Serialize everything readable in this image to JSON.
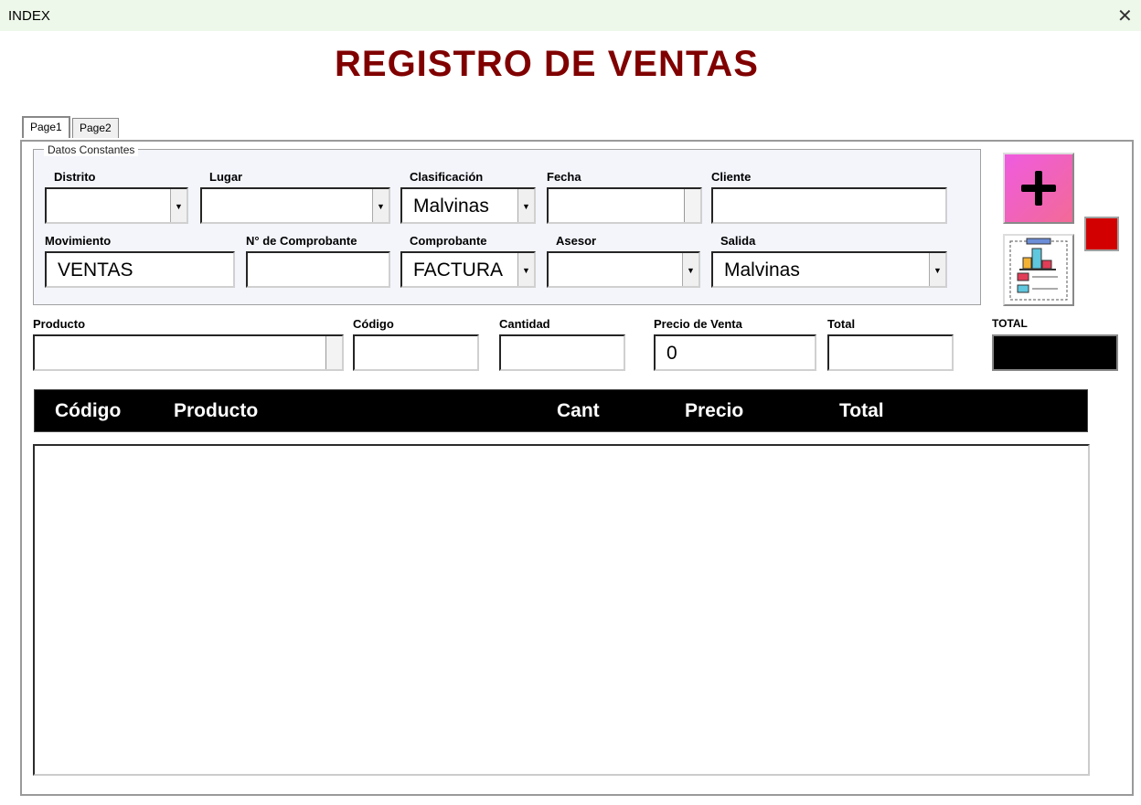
{
  "window": {
    "title": "INDEX",
    "close": "✕"
  },
  "heading": "REGISTRO DE VENTAS",
  "tabs": [
    {
      "label": "Page1"
    },
    {
      "label": "Page2"
    }
  ],
  "group": {
    "label": "Datos Constantes"
  },
  "fields": {
    "distrito": {
      "label": "Distrito",
      "value": ""
    },
    "lugar": {
      "label": "Lugar",
      "value": ""
    },
    "clasificacion": {
      "label": "Clasificación",
      "value": "Malvinas"
    },
    "fecha": {
      "label": "Fecha",
      "value": ""
    },
    "cliente": {
      "label": "Cliente",
      "value": ""
    },
    "movimiento": {
      "label": "Movimiento",
      "value": "VENTAS"
    },
    "comprobante_num": {
      "label": "N° de Comprobante",
      "value": ""
    },
    "comprobante": {
      "label": "Comprobante",
      "value": "FACTURA"
    },
    "asesor": {
      "label": "Asesor",
      "value": ""
    },
    "salida": {
      "label": "Salida",
      "value": "Malvinas"
    },
    "producto": {
      "label": "Producto",
      "value": ""
    },
    "codigo": {
      "label": "Código",
      "value": ""
    },
    "cantidad": {
      "label": "Cantidad",
      "value": ""
    },
    "precio_venta": {
      "label": "Precio de Venta",
      "value": "0"
    },
    "total": {
      "label": "Total",
      "value": ""
    },
    "grand_total": {
      "label": "TOTAL",
      "value": ""
    }
  },
  "table": {
    "columns": [
      "Código",
      "Producto",
      "Cant",
      "Precio",
      "Total"
    ],
    "rows": []
  },
  "colors": {
    "title": "#800000",
    "add_button": "#ef5be0",
    "red_indicator": "#d20000"
  },
  "icons": {
    "add": "plus-icon",
    "report": "chart-list-icon"
  }
}
